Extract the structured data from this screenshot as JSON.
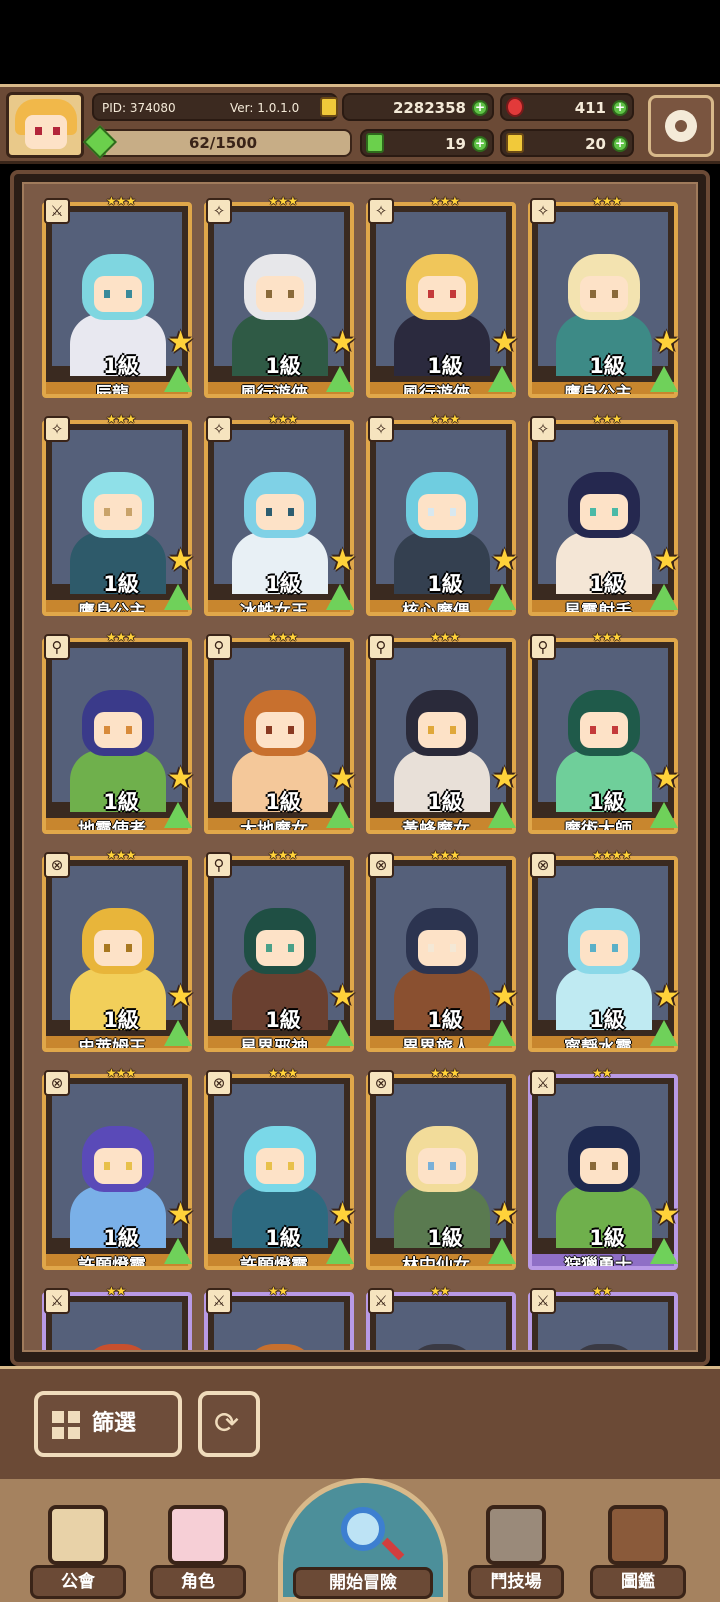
{
  "header": {
    "pid_label": "PID: 374080",
    "version_label": "Ver: 1.0.1.0",
    "gold": "2282358",
    "gems": "411",
    "energy": "19",
    "keys": "20",
    "exp_text": "62/1500",
    "exp_fraction": 0.041
  },
  "characters": [
    {
      "level": "1級",
      "name": "辰龍",
      "stars": "★★★",
      "cls": "⚔",
      "rarity": "gold",
      "palette": [
        "#7fd6e0",
        "#e8e8f0",
        "#3a8a9a"
      ]
    },
    {
      "level": "1級",
      "name": "風行遊俠",
      "stars": "★★★",
      "cls": "✧",
      "rarity": "gold",
      "palette": [
        "#e7e7ea",
        "#2f5a45",
        "#8a6a3a"
      ]
    },
    {
      "level": "1級",
      "name": "風行遊俠",
      "stars": "★★★",
      "cls": "✧",
      "rarity": "gold",
      "palette": [
        "#f0c65a",
        "#2b2a3e",
        "#c43a3a"
      ]
    },
    {
      "level": "1級",
      "name": "鷹身公主",
      "stars": "★★★",
      "cls": "✧",
      "rarity": "gold",
      "palette": [
        "#f3e3b0",
        "#3d8a86",
        "#8a6a3a"
      ]
    },
    {
      "level": "1級",
      "name": "鷹身公主",
      "stars": "★★★",
      "cls": "✧",
      "rarity": "gold",
      "palette": [
        "#8fe0e8",
        "#2e5a6a",
        "#c9a36a"
      ]
    },
    {
      "level": "1級",
      "name": "冰蛛女王",
      "stars": "★★★",
      "cls": "✧",
      "rarity": "gold",
      "palette": [
        "#7fd1e6",
        "#e8f0f5",
        "#2d5d70"
      ]
    },
    {
      "level": "1級",
      "name": "核心魔偶",
      "stars": "★★★",
      "cls": "✧",
      "rarity": "gold",
      "palette": [
        "#6fcde0",
        "#344050",
        "#d8e8f0"
      ]
    },
    {
      "level": "1級",
      "name": "星靈射手",
      "stars": "★★★",
      "cls": "✧",
      "rarity": "gold",
      "palette": [
        "#25284f",
        "#f4e6d6",
        "#4bb9a6"
      ]
    },
    {
      "level": "1級",
      "name": "地靈使者",
      "stars": "★★★",
      "cls": "⚲",
      "rarity": "gold",
      "palette": [
        "#3a3a8a",
        "#6fb04c",
        "#d88a3a"
      ]
    },
    {
      "level": "1級",
      "name": "大地魔女",
      "stars": "★★★",
      "cls": "⚲",
      "rarity": "gold",
      "palette": [
        "#c8702e",
        "#f4c89a",
        "#8a3a22"
      ]
    },
    {
      "level": "1級",
      "name": "黃蜂魔女",
      "stars": "★★★",
      "cls": "⚲",
      "rarity": "gold",
      "palette": [
        "#2a2a3a",
        "#e8e0d8",
        "#e0a83a"
      ]
    },
    {
      "level": "1級",
      "name": "魔術大師",
      "stars": "★★★",
      "cls": "⚲",
      "rarity": "gold",
      "palette": [
        "#1f5a4a",
        "#6fcf9a",
        "#c43a3a"
      ]
    },
    {
      "level": "1級",
      "name": "史萊姆王",
      "stars": "★★★",
      "cls": "⊗",
      "rarity": "gold",
      "palette": [
        "#e8b53a",
        "#f2cf5a",
        "#a87820"
      ]
    },
    {
      "level": "1級",
      "name": "星界邪神",
      "stars": "★★★",
      "cls": "⚲",
      "rarity": "gold",
      "palette": [
        "#1f4f44",
        "#6a4030",
        "#4aa088"
      ]
    },
    {
      "level": "1級",
      "name": "異界旅人",
      "stars": "★★★",
      "cls": "⊗",
      "rarity": "gold",
      "palette": [
        "#2c3450",
        "#8a5030",
        "#f4e8d6"
      ]
    },
    {
      "level": "1級",
      "name": "寧靜水靈",
      "stars": "★★★★",
      "cls": "⊗",
      "rarity": "gold",
      "palette": [
        "#8ad8e8",
        "#bfeaf2",
        "#5ab0c8"
      ]
    },
    {
      "level": "1級",
      "name": "許願燈靈",
      "stars": "★★★",
      "cls": "⊗",
      "rarity": "gold",
      "palette": [
        "#5a4ab8",
        "#7ab0e8",
        "#e8c04a"
      ]
    },
    {
      "level": "1級",
      "name": "許願燈靈",
      "stars": "★★★",
      "cls": "⊗",
      "rarity": "gold",
      "palette": [
        "#7ad8e8",
        "#2d6a80",
        "#e8c04a"
      ]
    },
    {
      "level": "1級",
      "name": "林中仙女",
      "stars": "★★★",
      "cls": "⊗",
      "rarity": "gold",
      "palette": [
        "#f2dc9a",
        "#5a7a50",
        "#7ab0d8"
      ]
    },
    {
      "level": "1級",
      "name": "狩獵勇士",
      "stars": "★★",
      "cls": "⚔",
      "rarity": "purple",
      "palette": [
        "#1f2a50",
        "#6fb04c",
        "#8a6a3a"
      ]
    },
    {
      "level": "",
      "name": "",
      "stars": "★★",
      "cls": "⚔",
      "rarity": "purple",
      "palette": [
        "#c8502e",
        "#3a2a20",
        "#8a3a22"
      ]
    },
    {
      "level": "",
      "name": "",
      "stars": "★★",
      "cls": "⚔",
      "rarity": "purple",
      "palette": [
        "#c8702e",
        "#3a2a20",
        "#8a5030"
      ]
    },
    {
      "level": "",
      "name": "",
      "stars": "★★",
      "cls": "⚔",
      "rarity": "purple",
      "palette": [
        "#3a3a44",
        "#e8e0d8",
        "#2a2a30"
      ]
    },
    {
      "level": "",
      "name": "",
      "stars": "★★",
      "cls": "⚔",
      "rarity": "purple",
      "palette": [
        "#3a3a44",
        "#e8e0d8",
        "#2a2a30"
      ]
    }
  ],
  "controls": {
    "filter_label": "篩選",
    "refresh_icon": "⟳"
  },
  "nav": {
    "guild": "公會",
    "character": "角色",
    "adventure": "開始冒險",
    "arena": "鬥技場",
    "codex": "圖鑑"
  },
  "colors": {
    "gold_frame": "#e0a74a",
    "purple_frame": "#b99ae6",
    "plus_green": "#5fc246"
  }
}
